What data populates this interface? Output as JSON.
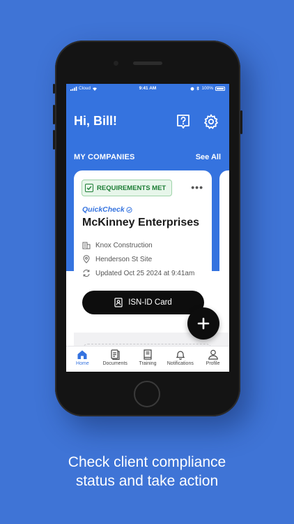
{
  "status_bar": {
    "carrier": "Cloud",
    "time": "9:41 AM",
    "battery": "100%"
  },
  "header": {
    "greeting": "Hi, Bill!",
    "help_icon": "help-icon",
    "settings_icon": "gear-icon"
  },
  "companies": {
    "section_title": "MY COMPANIES",
    "see_all": "See All",
    "card": {
      "badge": "REQUIREMENTS MET",
      "brand": "QuickCheck",
      "name": "McKinney Enterprises",
      "client": "Knox Construction",
      "site": "Henderson St Site",
      "updated": "Updated Oct 25 2024 at 9:41am",
      "button": "ISN-ID Card"
    }
  },
  "tabs": [
    {
      "label": "Home",
      "icon": "home-icon",
      "active": true
    },
    {
      "label": "Documents",
      "icon": "documents-icon"
    },
    {
      "label": "Training",
      "icon": "training-icon"
    },
    {
      "label": "Notifications",
      "icon": "bell-icon"
    },
    {
      "label": "Profile",
      "icon": "profile-icon"
    }
  ],
  "caption": {
    "line1": "Check client compliance",
    "line2": "status and take action"
  },
  "colors": {
    "background": "#3f74d6",
    "header": "#3573df",
    "success": "#1c7d35"
  }
}
